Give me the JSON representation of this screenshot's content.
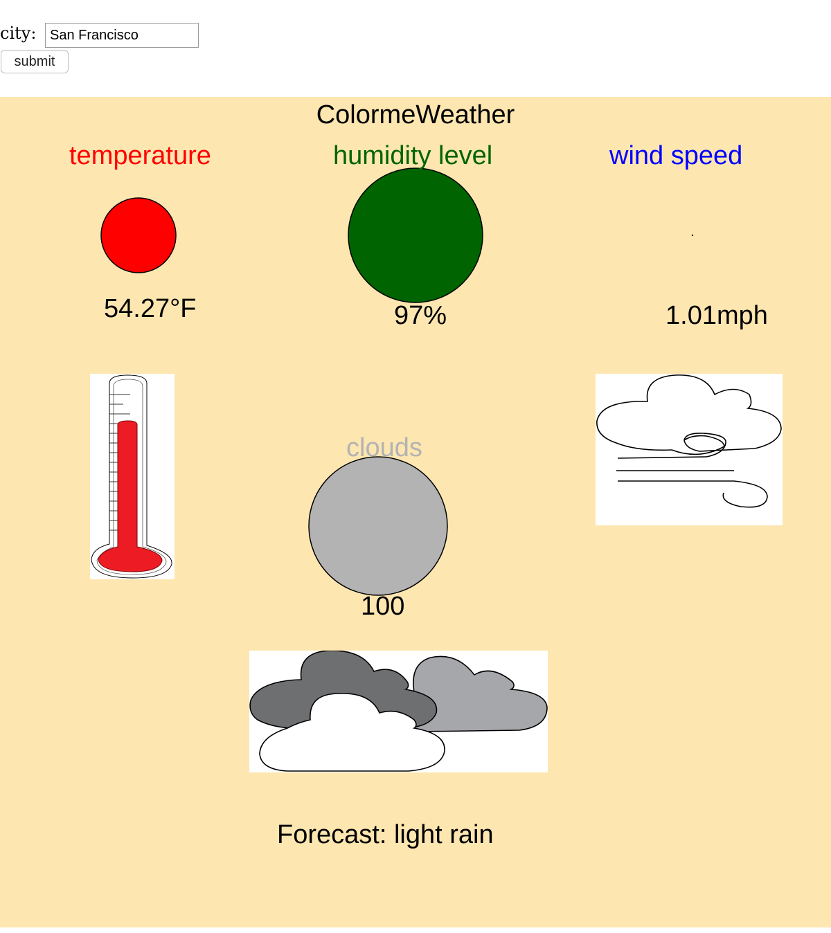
{
  "form": {
    "city_label": "city:",
    "city_value": "San Francisco",
    "submit_label": "submit"
  },
  "app": {
    "title": "ColormeWeather"
  },
  "labels": {
    "temperature": "temperature",
    "humidity": "humidity level",
    "wind": "wind speed",
    "clouds": "clouds"
  },
  "readings": {
    "temperature": "54.27°F",
    "humidity": "97%",
    "wind": "1.01mph",
    "clouds": "100",
    "forecast": "Forecast: light rain"
  },
  "colors": {
    "panel_bg": "#fde6b0",
    "temperature": "#ff0000",
    "humidity": "#006400",
    "wind": "#0000ff",
    "clouds": "#b3b3b3"
  },
  "icons": {
    "temperature": "thermometer-icon",
    "wind": "wind-cloud-icon",
    "clouds": "clouds-icon"
  }
}
